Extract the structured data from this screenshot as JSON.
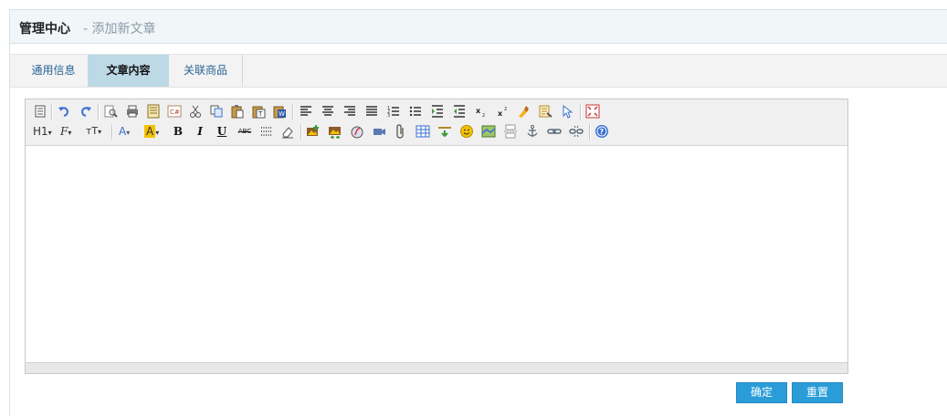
{
  "header": {
    "title": "管理中心",
    "subtitle": "- 添加新文章"
  },
  "tabs": [
    {
      "label": "通用信息",
      "active": false
    },
    {
      "label": "文章内容",
      "active": true
    },
    {
      "label": "关联商品",
      "active": false
    }
  ],
  "toolbar": {
    "row1": [
      "source-icon",
      "undo-icon",
      "redo-icon",
      "preview-icon",
      "print-icon",
      "template-icon",
      "code-icon",
      "cut-icon",
      "copy-icon",
      "paste-icon",
      "paste-text-icon",
      "paste-word-icon",
      "align-left-icon",
      "align-center-icon",
      "align-right-icon",
      "justify-icon",
      "ordered-list-icon",
      "unordered-list-icon",
      "indent-icon",
      "outdent-icon",
      "subscript-icon",
      "superscript-icon",
      "clear-format-icon",
      "quick-format-icon",
      "select-all-icon",
      "fullscreen-icon"
    ],
    "row2": [
      "heading-icon",
      "font-family-icon",
      "font-size-icon",
      "font-color-icon",
      "highlight-icon",
      "bold-icon",
      "italic-icon",
      "underline-icon",
      "strikethrough-icon",
      "line-height-icon",
      "remove-format-icon",
      "image-icon",
      "multi-image-icon",
      "flash-icon",
      "media-icon",
      "attachment-icon",
      "table-icon",
      "hr-icon",
      "emoticon-icon",
      "map-icon",
      "page-break-icon",
      "anchor-icon",
      "link-icon",
      "unlink-icon",
      "help-icon"
    ],
    "labels": {
      "heading": "H1",
      "font_family": "F",
      "font_size": "тT",
      "font_color": "A",
      "highlight": "A",
      "bold": "B",
      "italic": "I",
      "underline": "U",
      "strike": "ABC"
    },
    "colors": {
      "accent_red": "#e04a3a",
      "accent_blue": "#3a6fd0",
      "highlight_yellow": "#f3c200"
    }
  },
  "buttons": {
    "ok": "确定",
    "reset": "重置"
  },
  "colors": {
    "tab_active_bg": "#bdd9e6",
    "button_bg": "#2a9dd8",
    "header_bg": "#f1f6f9"
  }
}
